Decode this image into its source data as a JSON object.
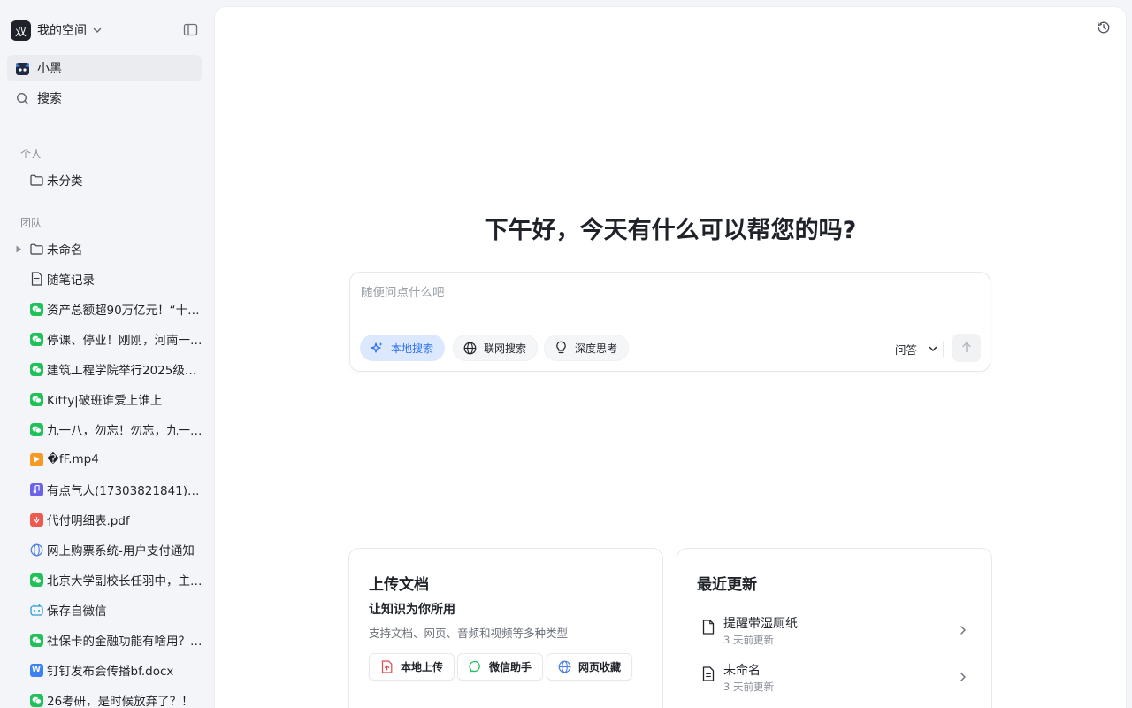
{
  "workspace": {
    "avatar_char": "双",
    "name": "我的空间"
  },
  "sidebar": {
    "assistant": {
      "label": "小黑"
    },
    "search": {
      "label": "搜索"
    },
    "personal_label": "个人",
    "personal_items": [
      {
        "label": "未分类",
        "icon": "folder-icon"
      }
    ],
    "team_label": "团队",
    "team_items": [
      {
        "label": "未命名",
        "icon": "folder-icon"
      },
      {
        "label": "随笔记录",
        "icon": "document-icon"
      },
      {
        "label": "资产总额超90万亿元！“十…",
        "icon": "wechat-icon"
      },
      {
        "label": "停课、停业！刚刚，河南一…",
        "icon": "wechat-icon"
      },
      {
        "label": "建筑工程学院举行2025级新…",
        "icon": "wechat-icon"
      },
      {
        "label": "Kitty|破班谁爱上谁上",
        "icon": "wechat-icon"
      },
      {
        "label": "九一八，勿忘！勿忘，九一…",
        "icon": "wechat-icon"
      },
      {
        "label": "�fF.mp4",
        "icon": "video-icon"
      },
      {
        "label": "有点气人(17303821841)_2…",
        "icon": "audio-icon"
      },
      {
        "label": "代付明细表.pdf",
        "icon": "pdf-icon"
      },
      {
        "label": "网上购票系统-用户支付通知",
        "icon": "globe-icon"
      },
      {
        "label": "北京大学副校长任羽中，主…",
        "icon": "wechat-icon"
      },
      {
        "label": "保存自微信",
        "icon": "bot-icon"
      },
      {
        "label": "社保卡的金融功能有啥用？…",
        "icon": "wechat-icon"
      },
      {
        "label": "钉钉发布会传播bf.docx",
        "icon": "word-icon"
      },
      {
        "label": "26考研，是时候放弃了？！",
        "icon": "wechat-icon"
      }
    ]
  },
  "main": {
    "greeting": "下午好，今天有什么可以帮您的吗?",
    "chat": {
      "placeholder": "随便问点什么吧",
      "chips": [
        {
          "label": "本地搜索",
          "icon": "sparkle-icon",
          "active": true
        },
        {
          "label": "联网搜索",
          "icon": "globe-icon",
          "active": false
        },
        {
          "label": "深度思考",
          "icon": "lightbulb-icon",
          "active": false
        }
      ],
      "mode": "问答"
    },
    "upload_card": {
      "title": "上传文档",
      "subtitle": "让知识为你所用",
      "description": "支持文档、网页、音频和视频等多种类型",
      "buttons": [
        {
          "label": "本地上传",
          "icon": "file-upload-icon"
        },
        {
          "label": "微信助手",
          "icon": "chat-bubble-icon"
        },
        {
          "label": "网页收藏",
          "icon": "globe-icon"
        }
      ]
    },
    "recent_card": {
      "title": "最近更新",
      "items": [
        {
          "title": "提醒带湿厕纸",
          "time": "3 天前更新"
        },
        {
          "title": "未命名",
          "time": "3 天前更新"
        }
      ]
    }
  },
  "colors": {
    "accent": "#2a6ff0",
    "wechat_green": "#21c15a",
    "sidebar_bg": "#f4f5f8"
  }
}
